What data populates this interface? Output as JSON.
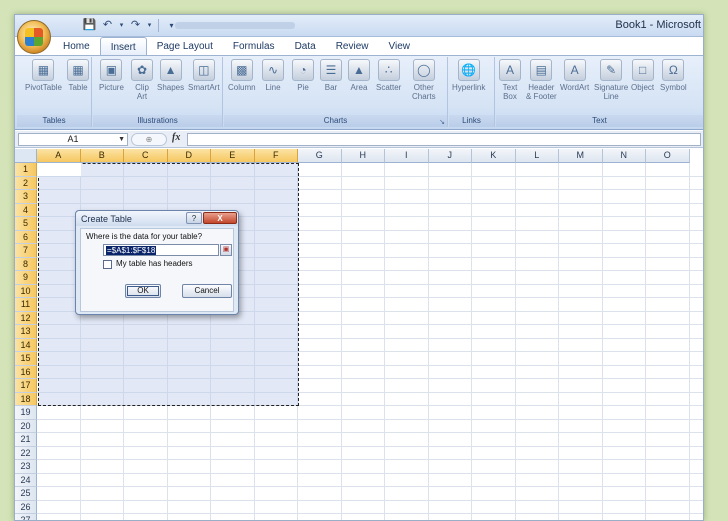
{
  "window": {
    "title": "Book1 - Microsoft",
    "quick_access": [
      "save-icon",
      "undo-icon",
      "redo-icon",
      "customize-icon"
    ]
  },
  "tabs": [
    "Home",
    "Insert",
    "Page Layout",
    "Formulas",
    "Data",
    "Review",
    "View"
  ],
  "active_tab": "Insert",
  "ribbon": {
    "tables": {
      "label": "Tables",
      "buttons": [
        "PivotTable",
        "Table"
      ]
    },
    "illustrations": {
      "label": "Illustrations",
      "buttons": [
        "Picture",
        "Clip\nArt",
        "Shapes",
        "SmartArt"
      ]
    },
    "charts": {
      "label": "Charts",
      "buttons": [
        "Column",
        "Line",
        "Pie",
        "Bar",
        "Area",
        "Scatter",
        "Other\nCharts"
      ]
    },
    "links": {
      "label": "Links",
      "buttons": [
        "Hyperlink"
      ]
    },
    "text": {
      "label": "Text",
      "buttons": [
        "Text\nBox",
        "Header\n& Footer",
        "WordArt",
        "Signature\nLine",
        "Object",
        "Symbol"
      ]
    }
  },
  "formula_bar": {
    "name_box": "A1",
    "fx": "fx",
    "value": ""
  },
  "columns": [
    "A",
    "B",
    "C",
    "D",
    "E",
    "F",
    "G",
    "H",
    "I",
    "J",
    "K",
    "L",
    "M",
    "N",
    "O"
  ],
  "rows": [
    "1",
    "2",
    "3",
    "4",
    "5",
    "6",
    "7",
    "8",
    "9",
    "10",
    "11",
    "12",
    "13",
    "14",
    "15",
    "16",
    "17",
    "18",
    "19",
    "20",
    "21",
    "22",
    "23",
    "24",
    "25",
    "26",
    "27"
  ],
  "selection": {
    "columns": [
      "A",
      "B",
      "C",
      "D",
      "E",
      "F"
    ],
    "rows_through": 18
  },
  "dialog": {
    "title": "Create Table",
    "help": "?",
    "close": "X",
    "question": "Where is the data for your table?",
    "range": "=$A$1:$F$18",
    "checkbox_label": "My table has headers",
    "checkbox_checked": false,
    "ok": "OK",
    "cancel": "Cancel"
  }
}
